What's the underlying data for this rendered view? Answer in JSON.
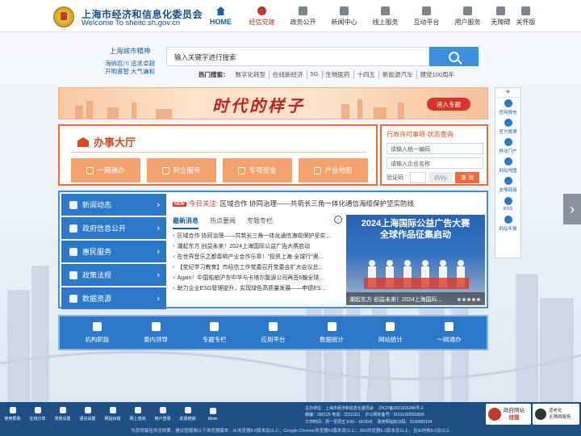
{
  "header": {
    "org_name": "上海市经济和信息化委员会",
    "org_sub": "Welcome To sheitc.sh.gov.cn",
    "nav": [
      {
        "label": "HOME",
        "icon": "home-icon"
      },
      {
        "label": "经信党建",
        "icon": "party-emblem-icon"
      },
      {
        "label": "政务公开",
        "icon": "chat-icon"
      },
      {
        "label": "新闻中心",
        "icon": "newspaper-icon"
      },
      {
        "label": "线上服务",
        "icon": "user-icon"
      },
      {
        "label": "互动平台",
        "icon": "messages-icon"
      },
      {
        "label": "用户服务",
        "icon": "people-icon"
      },
      {
        "label": "无障碍",
        "icon": "accessibility-icon"
      },
      {
        "label": "关怀版",
        "icon": "care-icon"
      }
    ]
  },
  "spirit": {
    "title": "上海城市精神",
    "lines": [
      "海纳百川 追求卓越",
      "开明睿智 大气谦和"
    ]
  },
  "search": {
    "placeholder": "输入关键字进行搜索",
    "hot_label": "热门搜索：",
    "hot_keywords": [
      "数字化转型",
      "在线新经济",
      "5G",
      "生物医药",
      "十四五",
      "新能源汽车",
      "建党100周年"
    ]
  },
  "banner": {
    "title": "时代的样子",
    "button": "进入专题"
  },
  "hall": {
    "title": "办事大厅",
    "buttons": [
      "一网通办",
      "利企服务",
      "专项资金",
      "产业地图"
    ]
  },
  "approval": {
    "title": "行政许可事项-状态查询",
    "code_placeholder": "请输入统一编码",
    "name_placeholder": "请输入企业名称",
    "captcha_label": "验证码",
    "captcha_text": "6Wy",
    "query_button": "查 询"
  },
  "left_menu": [
    {
      "label": "新闻动态",
      "icon": "chat-bubble-icon"
    },
    {
      "label": "政府信息公开",
      "icon": "document-icon"
    },
    {
      "label": "惠民服务",
      "icon": "building-icon"
    },
    {
      "label": "政策法规",
      "icon": "gavel-icon"
    },
    {
      "label": "数据资源",
      "icon": "database-icon"
    }
  ],
  "today": {
    "new_tag": "NEW",
    "prefix": "今日关注:",
    "text": "区域合作 协同治理——共筑长三角一体化通信海缆保护坚实防线"
  },
  "tabs": [
    "最新消息",
    "热点要闻",
    "专题专栏"
  ],
  "news_list": [
    "区域合作 协同治理——共筑长三角一体化通信海缆保护坚实...",
    "潮起东方 创益未来！2024上海国际公益广告大赛启动",
    "在世界音乐之都奏响产业合作乐章！\"投资上海·全球行\"奥...",
    "【党纪学习教育】市经信工作党委召开党委会扩大会议总...",
    "Again！中国船舶沪东中华与卡塔尔能源公司再签6艘全球...",
    "助力企业ESG管理提升，实现绿色高质量发展——申德ES..."
  ],
  "photo": {
    "title_line1": "2024上海国际公益广告大赛",
    "title_line2": "全球作品征集启动",
    "caption": "潮起东方 创益未来！2024上海国际..."
  },
  "quick_links": [
    {
      "label": "机构职能",
      "icon": "org-chart-icon"
    },
    {
      "label": "委内领导",
      "icon": "person-icon"
    },
    {
      "label": "专题专栏",
      "icon": "grid-icon"
    },
    {
      "label": "应用平台",
      "icon": "star-icon"
    },
    {
      "label": "数据统计",
      "icon": "pie-chart-icon"
    },
    {
      "label": "网站统计",
      "icon": "bar-chart-icon"
    },
    {
      "label": "一网通办",
      "icon": "link-icon"
    }
  ],
  "right_tools": {
    "plus": "+",
    "items": [
      {
        "label": "官网微信",
        "icon": "wechat-icon"
      },
      {
        "label": "官方微博",
        "icon": "weibo-icon"
      },
      {
        "label": "移动门户",
        "icon": "mobile-icon"
      },
      {
        "label": "网站地图",
        "icon": "sitemap-icon"
      },
      {
        "label": "友情链接",
        "icon": "link-icon"
      },
      {
        "label": "RSS",
        "icon": "rss-icon"
      },
      {
        "label": "网站年报",
        "icon": "report-icon"
      }
    ]
  },
  "footer": {
    "tools": [
      "使用帮助",
      "在线分享",
      "背景设置",
      "语言设置",
      "网站纠错",
      "网上咨询",
      "用户登录",
      "友情链接",
      "More"
    ],
    "info_lines": [
      [
        "主办单位：上海市经济和信息化委员会",
        "沪ICP备2021016245号-2"
      ],
      [
        "邮编：200125 电话：23111111",
        "沪公网安备号：31011302003506"
      ],
      [
        "工作时间：周一至周五 9:00－18:00点",
        "政府网站标识码：3100000104"
      ]
    ],
    "badge1_line1": "政府网站",
    "badge1_line2": "找错",
    "badge2_line1": "适老化",
    "badge2_line2": "无障碍服务",
    "note": "为获得最佳浏览效果，建议您使用以下浏览器版本：IE浏览器8.0版本及以上；Google Chrome浏览器63版本及以上；360浏览器9.1版本及以上，且IE内核9.0及以上"
  }
}
